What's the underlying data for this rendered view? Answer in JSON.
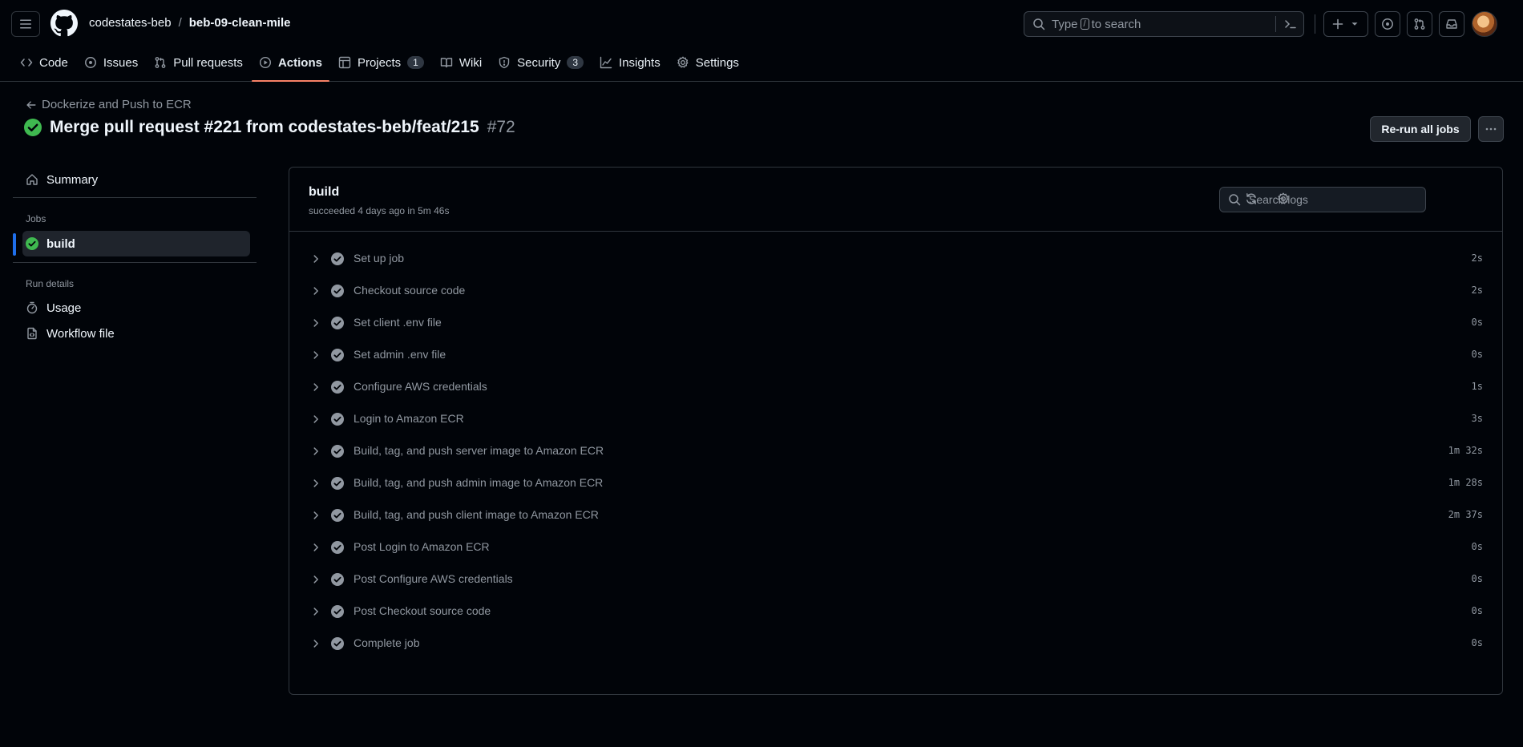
{
  "header": {
    "owner": "codestates-beb",
    "separator": "/",
    "repo": "beb-09-clean-mile",
    "search_prefix": "Type",
    "search_key": "/",
    "search_suffix": "to search"
  },
  "nav": {
    "code": "Code",
    "issues": "Issues",
    "pulls": "Pull requests",
    "actions": "Actions",
    "projects": "Projects",
    "projects_count": "1",
    "wiki": "Wiki",
    "security": "Security",
    "security_count": "3",
    "insights": "Insights",
    "settings": "Settings"
  },
  "page": {
    "back_label": "Dockerize and Push to ECR",
    "title": "Merge pull request #221 from codestates-beb/feat/215",
    "run_number": "#72",
    "rerun_label": "Re-run all jobs"
  },
  "sidebar": {
    "summary": "Summary",
    "jobs_heading": "Jobs",
    "job_build": "build",
    "run_details_heading": "Run details",
    "usage": "Usage",
    "workflow_file": "Workflow file"
  },
  "job": {
    "name": "build",
    "meta": "succeeded 4 days ago in 5m 46s",
    "search_placeholder": "Search logs",
    "steps": [
      {
        "name": "Set up job",
        "duration": "2s"
      },
      {
        "name": "Checkout source code",
        "duration": "2s"
      },
      {
        "name": "Set client .env file",
        "duration": "0s"
      },
      {
        "name": "Set admin .env file",
        "duration": "0s"
      },
      {
        "name": "Configure AWS credentials",
        "duration": "1s"
      },
      {
        "name": "Login to Amazon ECR",
        "duration": "3s"
      },
      {
        "name": "Build, tag, and push server image to Amazon ECR",
        "duration": "1m 32s"
      },
      {
        "name": "Build, tag, and push admin image to Amazon ECR",
        "duration": "1m 28s"
      },
      {
        "name": "Build, tag, and push client image to Amazon ECR",
        "duration": "2m 37s"
      },
      {
        "name": "Post Login to Amazon ECR",
        "duration": "0s"
      },
      {
        "name": "Post Configure AWS credentials",
        "duration": "0s"
      },
      {
        "name": "Post Checkout source code",
        "duration": "0s"
      },
      {
        "name": "Complete job",
        "duration": "0s"
      }
    ]
  },
  "colors": {
    "success": "#3fb950",
    "accent": "#f78166",
    "selected_bar": "#1f6feb"
  }
}
